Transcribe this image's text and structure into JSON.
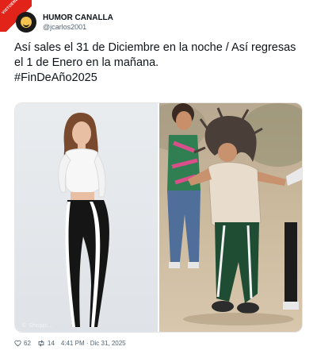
{
  "badge": {
    "text": "VISTOENLASREDES.com",
    "color": "#e2231a"
  },
  "author": {
    "display_name": "HUMOR CANALLA",
    "handle": "@jcarlos2001"
  },
  "tweet": {
    "line1": "Así sales el 31 de Diciembre en la noche / Así regresas",
    "line2": "el 1 de Enero en la mañana.",
    "hashtag": "#FinDeAño2025"
  },
  "media": {
    "left_photo_watermark": "© Shoppi..."
  },
  "footer": {
    "likes": "62",
    "retweets": "14",
    "timestamp": "4:41 PM · Dic 31, 2025"
  },
  "colors": {
    "text": "#0f1419",
    "muted": "#536471",
    "background": "#ffffff"
  }
}
